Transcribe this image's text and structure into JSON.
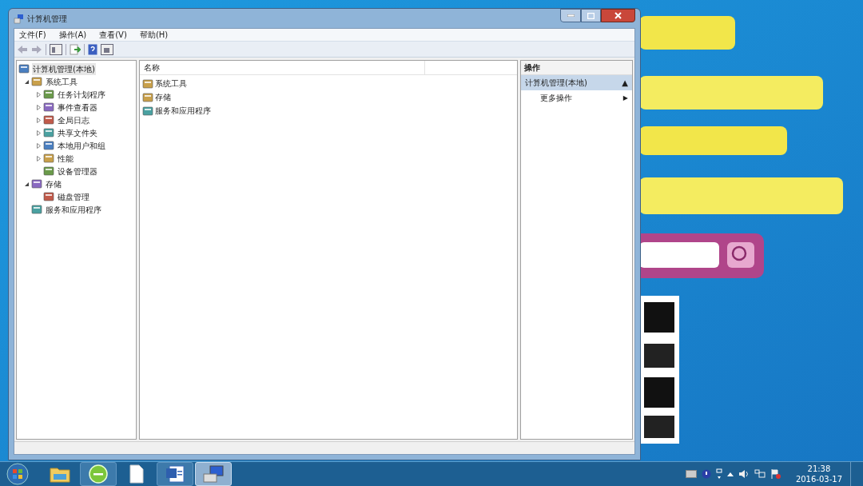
{
  "window": {
    "title": "计算机管理"
  },
  "menu": [
    "文件(F)",
    "操作(A)",
    "查看(V)",
    "帮助(H)"
  ],
  "tree": [
    {
      "label": "计算机管理(本地)",
      "selected": true,
      "children": [
        {
          "label": "系统工具",
          "expanded": true,
          "selected": false,
          "children": [
            {
              "label": "任务计划程序",
              "expanded": false,
              "selected": false
            },
            {
              "label": "事件查看器",
              "expanded": false,
              "selected": false
            },
            {
              "label": "全局日志",
              "expanded": false,
              "selected": false
            },
            {
              "label": "共享文件夹",
              "expanded": false,
              "selected": false
            },
            {
              "label": "本地用户和组",
              "expanded": false,
              "selected": false
            },
            {
              "label": "性能",
              "expanded": false,
              "selected": false
            },
            {
              "label": "设备管理器",
              "selected": false
            }
          ]
        },
        {
          "label": "存储",
          "expanded": true,
          "selected": false,
          "children": [
            {
              "label": "磁盘管理",
              "selected": false
            }
          ]
        },
        {
          "label": "服务和应用程序",
          "selected": false
        }
      ]
    }
  ],
  "list": {
    "columns": [
      "名称"
    ],
    "rows": [
      "系统工具",
      "存储",
      "服务和应用程序"
    ]
  },
  "actions": {
    "title": "操作",
    "items": [
      {
        "label": "计算机管理(本地)",
        "glyph": "▲",
        "kind": "header"
      },
      {
        "label": "更多操作",
        "glyph": "▶",
        "kind": "item"
      }
    ]
  },
  "taskbar": {
    "apps": [
      {
        "kind": "folder",
        "selected": false
      },
      {
        "kind": "globe",
        "selected": false
      },
      {
        "kind": "page",
        "selected": false
      },
      {
        "kind": "word",
        "selected": false
      },
      {
        "kind": "computer",
        "selected": true
      }
    ]
  },
  "clock": {
    "time": "21:38",
    "date": "2016-03-17"
  }
}
